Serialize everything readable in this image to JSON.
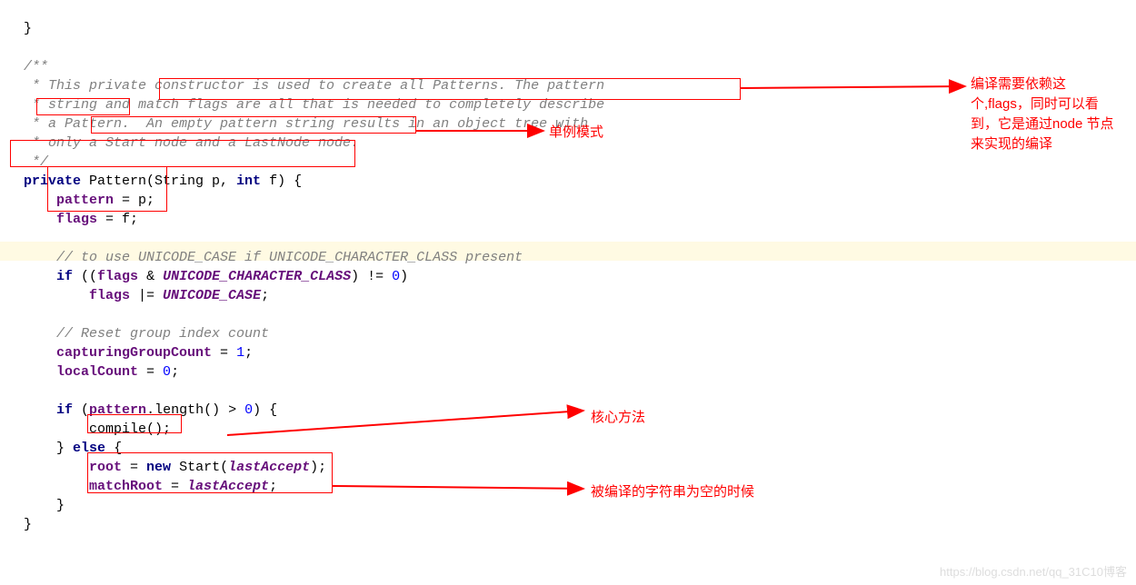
{
  "code": {
    "l0": "}",
    "l_blank": "",
    "c1": "/**",
    "c2": " * This private constructor is used to create all Patterns. The pattern",
    "c3": " * string and match flags are all that is needed to completely describe",
    "c4": " * a Pattern.  An empty pattern string results in an object tree with",
    "c5": " * only a Start node and a LastNode node.",
    "c6": " */",
    "kw_private": "private",
    "m_pattern_ctor": " Pattern(String p, ",
    "kw_int": "int",
    "m_pattern_tail": " f) {",
    "assign1_a": "pattern",
    "assign1_b": " = p;",
    "assign2_a": "flags",
    "assign2_b": " = f;",
    "c_uc": "// to use UNICODE_CASE if UNICODE_CHARACTER_CLASS present",
    "kw_if": "if",
    "if1_a": " ((",
    "fld_flags": "flags",
    "if1_amp": " & ",
    "uc_class": "UNICODE_CHARACTER_CLASS",
    "if1_b": ") != ",
    "zero": "0",
    "if1_c": ")",
    "or_a": "flags",
    "or_b": " |= ",
    "uc_case": "UNICODE_CASE",
    "semi": ";",
    "c_reset": "// Reset group index count",
    "cgc_a": "capturingGroupCount",
    "eq": " = ",
    "one": "1",
    "lc_a": "localCount",
    "if2_a": " (",
    "fld_pattern": "pattern",
    "len": ".length() > ",
    "if2_c": ") {",
    "compile": "compile();",
    "brace_close": "}",
    "kw_else": "else",
    "else_tail": " {",
    "root_a": "root",
    "root_b": " = ",
    "kw_new": "new",
    "start_a": " Start(",
    "lastAccept": "lastAccept",
    "start_b": ");",
    "mr_a": "matchRoot",
    "mr_b": " = ",
    "mr_c": ";"
  },
  "annotations": {
    "singleton": "单例模式",
    "compile_note": "编译需要依赖这个,flags，同时可以看到，它是通过node 节点来实现的编译",
    "core_method": "核心方法",
    "empty_string": "被编译的字符串为空的时候"
  },
  "watermark": "https://blog.csdn.net/qq_31C10博客"
}
